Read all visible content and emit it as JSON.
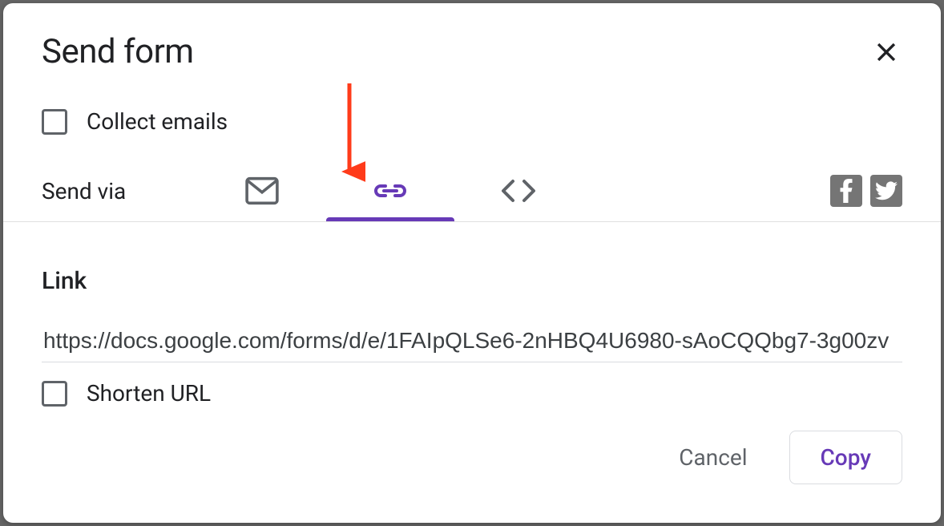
{
  "dialog": {
    "title": "Send form",
    "collect_emails_label": "Collect emails",
    "send_via_label": "Send via",
    "link_heading": "Link",
    "url_value": "https://docs.google.com/forms/d/e/1FAIpQLSe6-2nHBQ4U6980-sAoCQQbg7-3g00zv",
    "shorten_url_label": "Shorten URL",
    "cancel_label": "Cancel",
    "copy_label": "Copy"
  },
  "tabs": {
    "active": "link",
    "items": [
      "email",
      "link",
      "embed"
    ]
  },
  "colors": {
    "accent": "#673ab7",
    "annotation": "#ff3b1a"
  }
}
